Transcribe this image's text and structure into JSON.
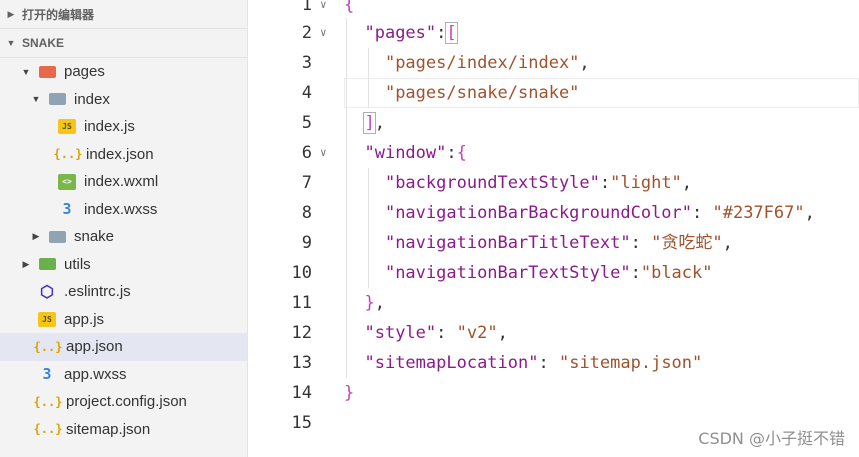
{
  "sidebar": {
    "open_editors_label": "打开的编辑器",
    "project_label": "SNAKE",
    "items": [
      {
        "label": "pages"
      },
      {
        "label": "index"
      },
      {
        "label": "index.js",
        "icon_text": "JS"
      },
      {
        "label": "index.json",
        "icon_text": "{..}"
      },
      {
        "label": "index.wxml",
        "icon_text": "<>"
      },
      {
        "label": "index.wxss",
        "icon_text": "3"
      },
      {
        "label": "snake"
      },
      {
        "label": "utils"
      },
      {
        "label": ".eslintrc.js",
        "icon_text": "⬡"
      },
      {
        "label": "app.js",
        "icon_text": "JS"
      },
      {
        "label": "app.json",
        "icon_text": "{..}"
      },
      {
        "label": "app.wxss",
        "icon_text": "3"
      },
      {
        "label": "project.config.json",
        "icon_text": "{..}"
      },
      {
        "label": "sitemap.json",
        "icon_text": "{..}"
      }
    ]
  },
  "editor": {
    "line_numbers": [
      "1",
      "2",
      "3",
      "4",
      "5",
      "6",
      "7",
      "8",
      "9",
      "10",
      "11",
      "12",
      "13",
      "14",
      "15"
    ],
    "tokens": {
      "l1_brace": "{",
      "l2_key": "\"pages\"",
      "l2_colon": ":",
      "l2_bracket": "[",
      "l3_value": "\"pages/index/index\"",
      "l3_comma": ",",
      "l4_value": "\"pages/snake/snake\"",
      "l5_bracket": "]",
      "l5_comma": ",",
      "l6_key": "\"window\"",
      "l6_colon": ":",
      "l6_brace": "{",
      "l7_key": "\"backgroundTextStyle\"",
      "l7_colon": ":",
      "l7_value": "\"light\"",
      "l7_comma": ",",
      "l8_key": "\"navigationBarBackgroundColor\"",
      "l8_colon": ": ",
      "l8_value": "\"#237F67\"",
      "l8_comma": ",",
      "l9_key": "\"navigationBarTitleText\"",
      "l9_colon": ": ",
      "l9_value": "\"贪吃蛇\"",
      "l9_comma": ",",
      "l10_key": "\"navigationBarTextStyle\"",
      "l10_colon": ":",
      "l10_value": "\"black\"",
      "l11_brace": "}",
      "l11_comma": ",",
      "l12_key": "\"style\"",
      "l12_colon": ": ",
      "l12_value": "\"v2\"",
      "l12_comma": ",",
      "l13_key": "\"sitemapLocation\"",
      "l13_colon": ": ",
      "l13_value": "\"sitemap.json\"",
      "l14_brace": "}"
    }
  },
  "watermark": "CSDN @小子挺不错",
  "colors": {
    "key": "#8b1a8b",
    "string": "#a0522d",
    "selected_row": "#e4e6f1",
    "sidebar_bg": "#f3f3f3"
  }
}
